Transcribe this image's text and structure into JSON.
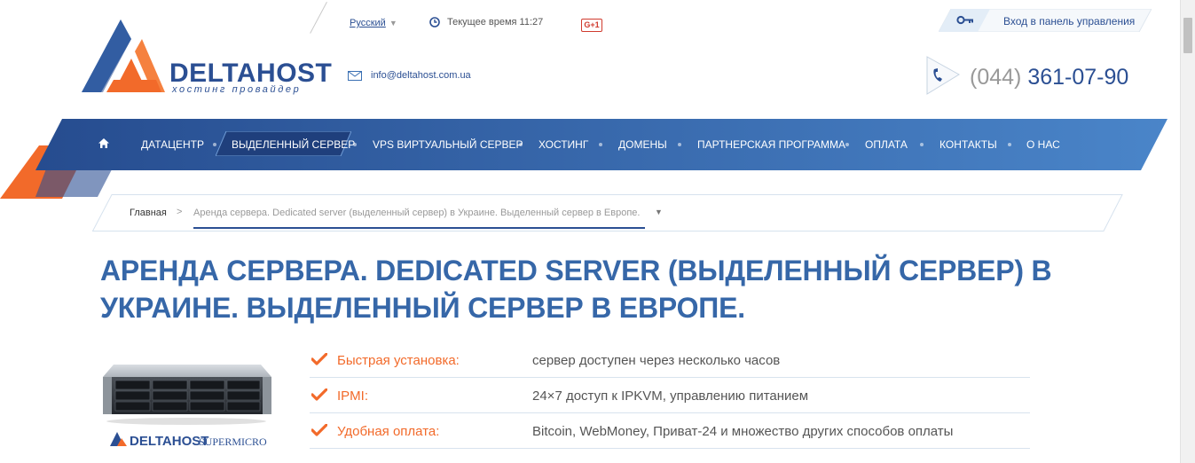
{
  "header": {
    "logo": {
      "brand": "DELTAHOST",
      "tagline": "хостинг провайдер"
    },
    "language": {
      "selected": "Русский"
    },
    "clock": {
      "label": "Текущее время 11:27"
    },
    "gplus_label": "G+1",
    "email": "info@deltahost.com.ua",
    "login_label": "Вход в панель управления",
    "phone": {
      "code": "(044)",
      "number": "361-07-90"
    }
  },
  "nav": {
    "items": [
      {
        "label": "ДАТАЦЕНТР"
      },
      {
        "label": "ВЫДЕЛЕННЫЙ СЕРВЕР",
        "active": true
      },
      {
        "label": "VPS ВИРТУАЛЬНЫЙ СЕРВЕР"
      },
      {
        "label": "ХОСТИНГ"
      },
      {
        "label": "ДОМЕНЫ"
      },
      {
        "label": "ПАРТНЕРСКАЯ ПРОГРАММА"
      },
      {
        "label": "ОПЛАТА"
      },
      {
        "label": "КОНТАКТЫ"
      },
      {
        "label": "О НАС"
      }
    ]
  },
  "breadcrumb": {
    "home": "Главная",
    "separator": ">",
    "current": "Аренда сервера. Dedicated server (выделенный сервер) в Украине. Выделенный сервер в Европе."
  },
  "page": {
    "title": "Аренда сервера. Dedicated server (выделенный сервер) в Украине. Выделенный сервер в Европе."
  },
  "server_image": {
    "brand": "DELTAHOST",
    "partner": "SUPERMICRO"
  },
  "features": [
    {
      "label": "Быстрая установка:",
      "value": "сервер доступен через несколько часов"
    },
    {
      "label": "IPMI:",
      "value": "24×7 доступ к IPKVM, управлению питанием"
    },
    {
      "label": "Удобная оплата:",
      "value": "Bitcoin, WebMoney, Приват-24 и множество других способов оплаты"
    }
  ],
  "colors": {
    "brand_blue": "#2b4f93",
    "title_blue": "#3667a8",
    "accent_orange": "#f26a2a"
  }
}
